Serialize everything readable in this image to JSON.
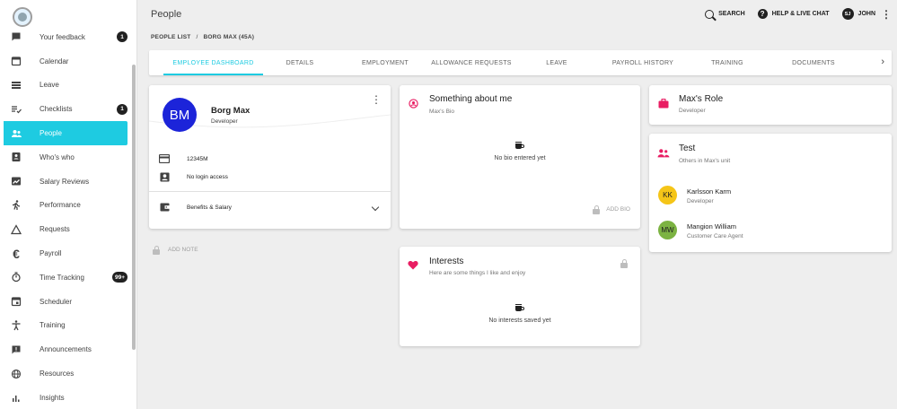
{
  "topbar": {
    "title": "People",
    "search_label": "SEARCH",
    "help_label": "HELP & LIVE CHAT",
    "user_initials": "SJ",
    "user_name": "JOHN"
  },
  "breadcrumb": {
    "root": "PEOPLE LIST",
    "separator": "/",
    "current": "BORG MAX (45A)"
  },
  "sidebar": {
    "items": [
      {
        "label": "Your feedback",
        "icon": "feedback-icon",
        "badge": "1"
      },
      {
        "label": "Calendar",
        "icon": "calendar-icon",
        "badge": ""
      },
      {
        "label": "Leave",
        "icon": "leave-icon",
        "badge": ""
      },
      {
        "label": "Checklists",
        "icon": "checklist-icon",
        "badge": "1"
      },
      {
        "label": "People",
        "icon": "people-icon",
        "badge": "",
        "active": true
      },
      {
        "label": "Who's who",
        "icon": "badge-icon",
        "badge": ""
      },
      {
        "label": "Salary Reviews",
        "icon": "salary-icon",
        "badge": ""
      },
      {
        "label": "Performance",
        "icon": "performance-icon",
        "badge": ""
      },
      {
        "label": "Requests",
        "icon": "requests-icon",
        "badge": ""
      },
      {
        "label": "Payroll",
        "icon": "euro-icon",
        "badge": ""
      },
      {
        "label": "Time Tracking",
        "icon": "timer-icon",
        "badge": "99+"
      },
      {
        "label": "Scheduler",
        "icon": "scheduler-icon",
        "badge": ""
      },
      {
        "label": "Training",
        "icon": "training-icon",
        "badge": ""
      },
      {
        "label": "Announcements",
        "icon": "announcement-icon",
        "badge": ""
      },
      {
        "label": "Resources",
        "icon": "globe-icon",
        "badge": ""
      },
      {
        "label": "Insights",
        "icon": "insights-icon",
        "badge": ""
      }
    ]
  },
  "tabs": [
    {
      "label": "EMPLOYEE DASHBOARD",
      "active": true
    },
    {
      "label": "DETAILS"
    },
    {
      "label": "EMPLOYMENT"
    },
    {
      "label": "ALLOWANCE REQUESTS"
    },
    {
      "label": "LEAVE"
    },
    {
      "label": "PAYROLL HISTORY"
    },
    {
      "label": "TRAINING"
    },
    {
      "label": "DOCUMENTS"
    }
  ],
  "profile": {
    "initials": "BM",
    "name": "Borg Max",
    "role": "Developer",
    "employee_code": "12345M",
    "login_status": "No login access",
    "benefits_label": "Benefits & Salary",
    "avatar_color": "#1c24d9"
  },
  "add_note_label": "ADD NOTE",
  "bio": {
    "title": "Something about me",
    "subtitle": "Max's Bio",
    "empty_text": "No bio entered yet",
    "add_label": "ADD BIO"
  },
  "interests": {
    "title": "Interests",
    "subtitle": "Here are some things I like and enjoy",
    "empty_text": "No interests saved yet"
  },
  "role_card": {
    "title": "Max's Role",
    "subtitle": "Developer"
  },
  "team": {
    "title": "Test",
    "subtitle": "Others in Max's unit",
    "members": [
      {
        "initials": "KK",
        "name": "Karlsson Karm",
        "role": "Developer",
        "color": "#f5c518"
      },
      {
        "initials": "MW",
        "name": "Mangion William",
        "role": "Customer Care Agent",
        "color": "#7cb342"
      }
    ]
  },
  "colors": {
    "accent": "#1ecbe1",
    "pink": "#e91e63"
  }
}
